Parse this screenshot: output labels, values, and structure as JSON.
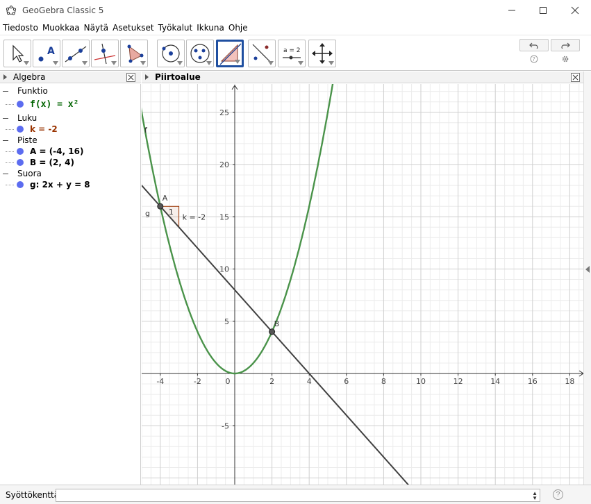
{
  "window": {
    "title": "GeoGebra Classic 5"
  },
  "menu": [
    "Tiedosto",
    "Muokkaa",
    "Näytä",
    "Asetukset",
    "Työkalut",
    "Ikkuna",
    "Ohje"
  ],
  "toolbar": {
    "tools": [
      {
        "name": "move-tool-button",
        "icon": "arrow-pointer-icon"
      },
      {
        "name": "point-tool-button",
        "icon": "point-a-icon"
      },
      {
        "name": "line-tool-button",
        "icon": "line-through-points-icon"
      },
      {
        "name": "perpendicular-tool-button",
        "icon": "perpendicular-line-icon"
      },
      {
        "name": "polygon-tool-button",
        "icon": "polygon-icon"
      },
      {
        "name": "circle-tool-button",
        "icon": "circle-center-point-icon"
      },
      {
        "name": "ellipse-tool-button",
        "icon": "ellipse-icon"
      },
      {
        "name": "slope-tool-button",
        "icon": "slope-triangle-icon"
      },
      {
        "name": "reflect-tool-button",
        "icon": "reflect-about-line-icon"
      },
      {
        "name": "slider-tool-button",
        "icon": "slider-icon",
        "label": "a = 2"
      },
      {
        "name": "move-view-tool-button",
        "icon": "move-graphics-view-icon"
      }
    ],
    "selected_index": 7,
    "undo_icon": "undo-icon",
    "redo_icon": "redo-icon",
    "help_icon": "help-icon",
    "settings_icon": "gear-icon"
  },
  "algebra": {
    "header": "Algebra",
    "categories": [
      {
        "label": "Funktio",
        "items": [
          {
            "text": "f(x) = x²",
            "color": "#006400"
          }
        ]
      },
      {
        "label": "Luku",
        "items": [
          {
            "text": "k = -2",
            "color": "#993300"
          }
        ]
      },
      {
        "label": "Piste",
        "items": [
          {
            "text": "A = (-4, 16)",
            "color": "#000000"
          },
          {
            "text": "B = (2, 4)",
            "color": "#000000"
          }
        ]
      },
      {
        "label": "Suora",
        "items": [
          {
            "text": "g: 2x + y = 8",
            "color": "#000000"
          }
        ]
      }
    ]
  },
  "graphics": {
    "header": "Piirtoalue",
    "x_ticks": [
      -4,
      -2,
      0,
      2,
      4,
      6,
      8,
      10,
      12,
      14,
      16,
      18
    ],
    "y_ticks": [
      -5,
      5,
      10,
      15,
      20,
      25
    ],
    "function_label": "f",
    "function_color": "#4a934a",
    "line_label": "g",
    "line_color": "#404040",
    "points": [
      {
        "label": "A",
        "x": -4,
        "y": 16
      },
      {
        "label": "B",
        "x": 2,
        "y": 4
      }
    ],
    "slope": {
      "label": "k = -2",
      "run_label": "1",
      "color": "#993300"
    }
  },
  "inputbar": {
    "label": "Syöttökenttä:",
    "value": "",
    "help_icon": "help-icon"
  }
}
